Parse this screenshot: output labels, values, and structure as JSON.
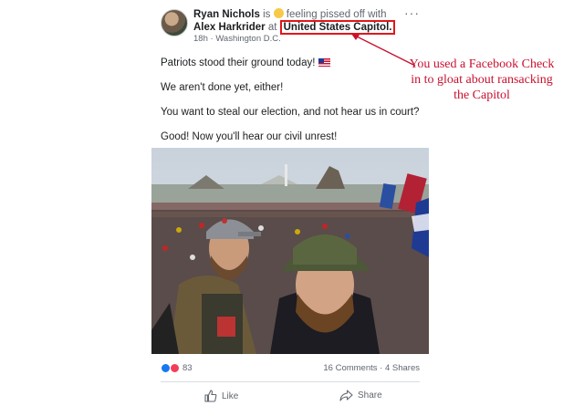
{
  "post": {
    "author": "Ryan Nichols",
    "is_text": "is",
    "feeling_text": "feeling pissed off with",
    "tagged": "Alex Harkrider",
    "at_text": "at",
    "place": "United States Capitol.",
    "time": "18h",
    "location": "Washington D.C.",
    "more_icon": "···",
    "lines": [
      "Patriots stood their ground today!",
      "We aren't done yet, either!",
      "You want to steal our election, and not hear us in court?",
      "Good! Now you'll hear our civil unrest!"
    ],
    "reaction_count": "83",
    "comments": "16 Comments",
    "shares": "4 Shares",
    "like_label": "Like",
    "share_label": "Share"
  },
  "annotation": {
    "text": "You used a Facebook Check in to gloat about ransacking the Capitol",
    "color": "#c8102e"
  },
  "colors": {
    "highlight_box": "#e0171b",
    "like_blue": "#1877f2",
    "love_red": "#f33e58"
  }
}
